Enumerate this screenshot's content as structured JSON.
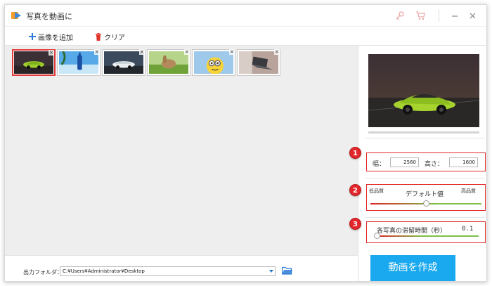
{
  "window": {
    "title": "写真を動画に"
  },
  "toolbar": {
    "add_label": "画像を追加",
    "clear_label": "クリア"
  },
  "thumbnails": [
    {
      "name": "green-sports-car",
      "selected": true
    },
    {
      "name": "blue-bottle-beach",
      "selected": false
    },
    {
      "name": "white-car",
      "selected": false
    },
    {
      "name": "rabbit-on-grass",
      "selected": false
    },
    {
      "name": "minion",
      "selected": false
    },
    {
      "name": "laptop",
      "selected": false
    }
  ],
  "thumbnail_close_glyph": "×",
  "settings": {
    "size": {
      "width_label": "幅：",
      "width_value": "2560",
      "height_label": "高さ：",
      "height_value": "1600"
    },
    "quality": {
      "low_label": "低品質",
      "default_label": "デフォルト値",
      "high_label": "高品質",
      "level": 0.5
    },
    "duration": {
      "label": "各写真の滞留時間（秒）",
      "value": "0.1",
      "level": 0.0
    }
  },
  "badges": [
    "1",
    "2",
    "3"
  ],
  "output": {
    "label": "出力フォルダ：",
    "path": "C:¥Users¥Administrator¥Desktop"
  },
  "create_button_label": "動画を作成",
  "colors": {
    "accent": "#1aa9ee",
    "highlight": "#e32828",
    "add_icon": "#2a7ad6"
  }
}
